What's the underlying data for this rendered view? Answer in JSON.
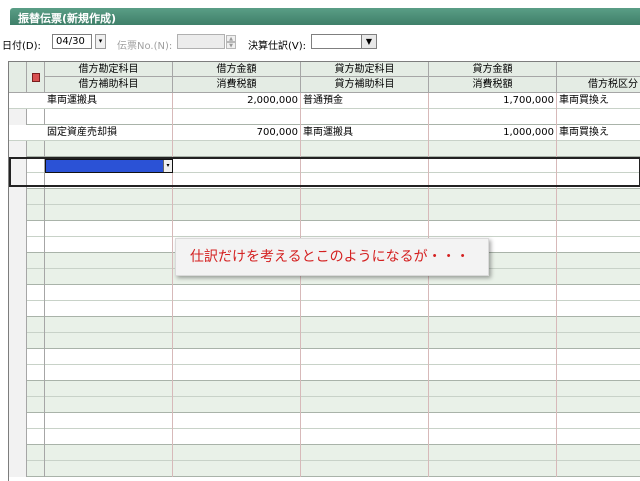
{
  "window": {
    "title": "振替伝票(新規作成)"
  },
  "toolbar": {
    "date_label": "日付(D):",
    "date_value": "04/30",
    "slip_no_label": "伝票No.(N):",
    "slip_no_value": "",
    "closing_label": "決算仕訳(V):",
    "closing_value": ""
  },
  "columns": {
    "top": [
      "借方勘定科目",
      "借方金額",
      "貸方勘定科目",
      "貸方金額"
    ],
    "bottom": [
      "借方補助科目",
      "消費税額",
      "貸方補助科目",
      "消費税額",
      "借方税区分"
    ]
  },
  "entries": [
    {
      "debit_account": "車両運搬具",
      "debit_amount": "2,000,000",
      "credit_account": "普通預金",
      "credit_amount": "1,700,000",
      "tax_class": "車両買換え"
    },
    {
      "debit_account": "固定資産売却損",
      "debit_amount": "700,000",
      "credit_account": "車両運搬具",
      "credit_amount": "1,000,000",
      "tax_class": "車両買換え"
    }
  ],
  "callout": {
    "text": "仕訳だけを考えるとこのようになるが・・・"
  },
  "colors": {
    "title_bar": "#3f7f69",
    "callout_text": "#d42020",
    "selection": "#2b52d6"
  },
  "icons": {
    "row_header": "document-icon",
    "date_picker": "dropdown-arrow-icon",
    "closing_dropdown": "dropdown-arrow-icon",
    "cell_dropdown": "dropdown-arrow-icon"
  }
}
